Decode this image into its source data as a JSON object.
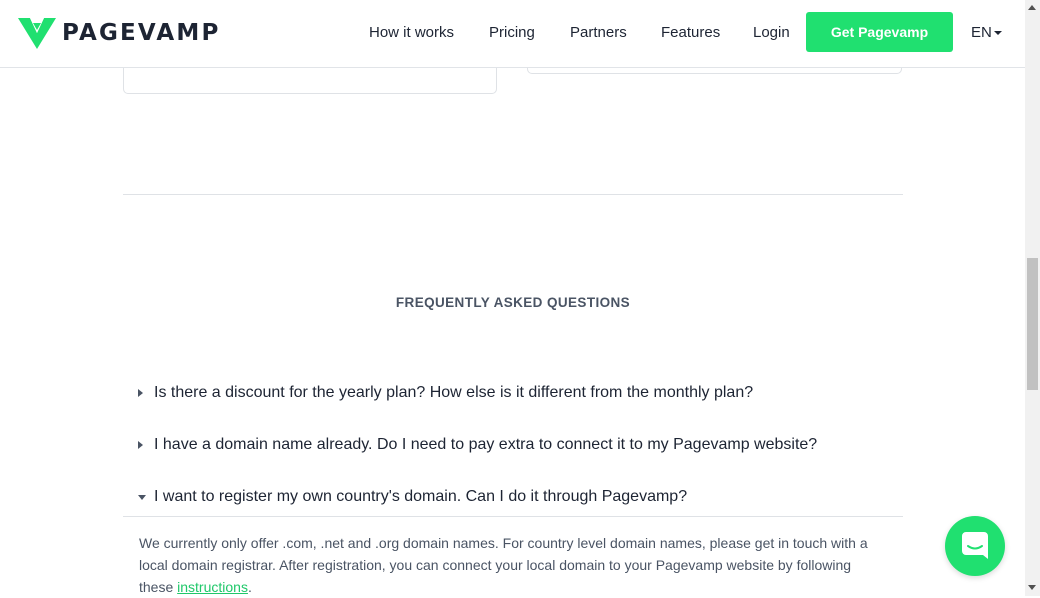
{
  "header": {
    "logo_text": "PAGEVAMP",
    "nav": [
      "How it works",
      "Pricing",
      "Partners",
      "Features",
      "Login"
    ],
    "cta_label": "Get Pagevamp",
    "language": "EN"
  },
  "faq": {
    "title": "FREQUENTLY ASKED QUESTIONS",
    "items": [
      {
        "question": "Is there a discount for the yearly plan? How else is it different from the monthly plan?",
        "expanded": false
      },
      {
        "question": "I have a domain name already. Do I need to pay extra to connect it to my Pagevamp website?",
        "expanded": false
      },
      {
        "question": "I want to register my own country's domain. Can I do it through Pagevamp?",
        "expanded": true
      }
    ],
    "answer_text": "We currently only offer .com, .net and .org domain names. For country level domain names, please get in touch with a local domain registrar. After registration, you can connect your local domain to your Pagevamp website by following these ",
    "answer_link": "instructions",
    "answer_end": "."
  },
  "colors": {
    "accent": "#20e070",
    "text": "#1d2433",
    "muted": "#4a5464"
  },
  "icons": {
    "logo": "pagevamp-v-logo",
    "chat": "chat-bubble-icon"
  }
}
